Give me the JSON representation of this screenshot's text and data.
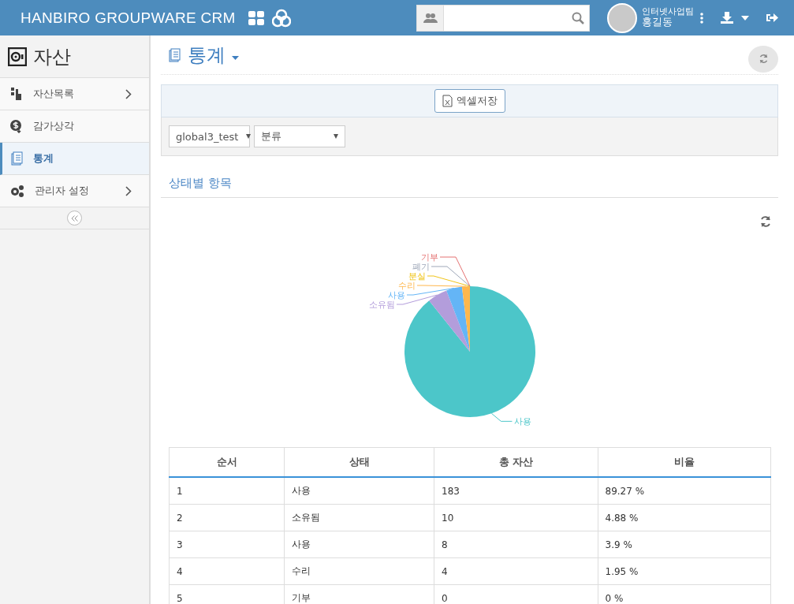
{
  "header": {
    "brand": "HANBIRO GROUPWARE CRM",
    "user": {
      "team": "인터넷사업팀",
      "name": "홍길동"
    }
  },
  "sidebar": {
    "title": "자산",
    "items": [
      {
        "label": "자산목록",
        "selected": false,
        "expandable": true
      },
      {
        "label": "감가상각",
        "selected": false,
        "expandable": false
      },
      {
        "label": "통계",
        "selected": true,
        "expandable": false
      },
      {
        "label": "관리자 설정",
        "selected": false,
        "expandable": true
      }
    ]
  },
  "page": {
    "title": "통계",
    "export_button": "엑셀저장",
    "filters": [
      {
        "value": "global3_test"
      },
      {
        "value": "분류"
      }
    ],
    "section_title": "상태별 항목"
  },
  "chart_data": {
    "type": "pie",
    "categories": [
      "사용",
      "소유됨",
      "사용",
      "수리",
      "분실",
      "폐기",
      "기부"
    ],
    "series": [
      {
        "values": [
          89.27,
          4.88,
          3.9,
          1.95,
          0,
          0,
          0
        ]
      }
    ]
  },
  "table": {
    "columns": [
      "순서",
      "상태",
      "총 자산",
      "비율"
    ],
    "rows": [
      [
        "1",
        "사용",
        "183",
        "89.27 %"
      ],
      [
        "2",
        "소유됨",
        "10",
        "4.88 %"
      ],
      [
        "3",
        "사용",
        "8",
        "3.9 %"
      ],
      [
        "4",
        "수리",
        "4",
        "1.95 %"
      ],
      [
        "5",
        "기부",
        "0",
        "0 %"
      ]
    ]
  }
}
